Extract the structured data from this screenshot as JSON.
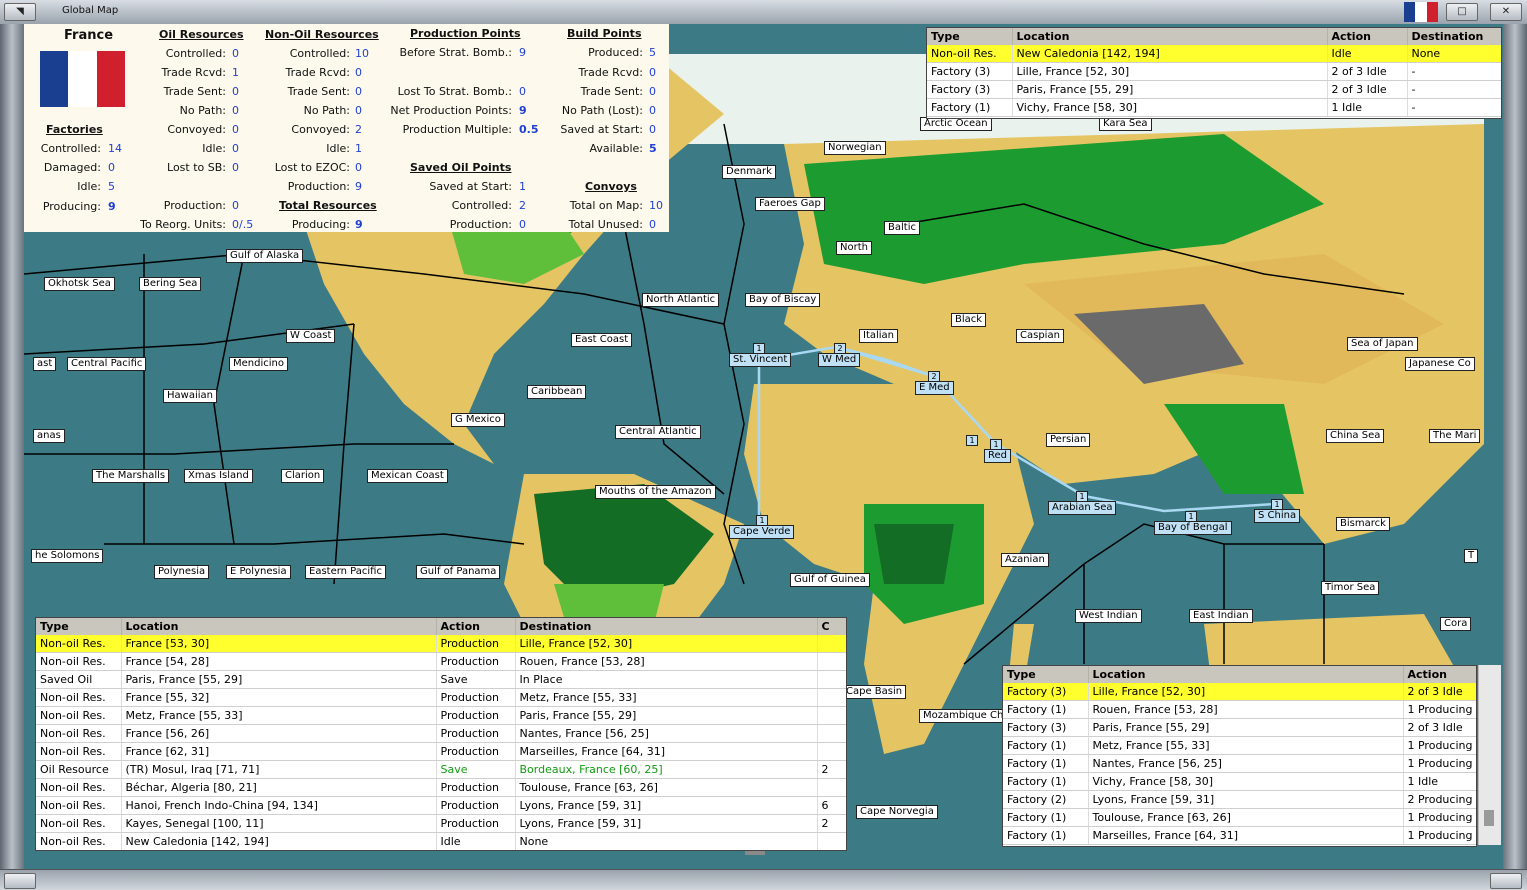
{
  "window": {
    "title": "Global Map"
  },
  "summary": {
    "country": "France",
    "factories": {
      "heading": "Factories",
      "rows": [
        {
          "label": "Controlled:",
          "value": "14"
        },
        {
          "label": "Damaged:",
          "value": "0"
        },
        {
          "label": "Idle:",
          "value": "5"
        },
        {
          "label": "Producing:",
          "value": "9"
        }
      ]
    },
    "oil": {
      "heading": "Oil Resources",
      "rows": [
        {
          "label": "Controlled:",
          "value": "0"
        },
        {
          "label": "Trade Rcvd:",
          "value": "1"
        },
        {
          "label": "Trade Sent:",
          "value": "0"
        },
        {
          "label": "No Path:",
          "value": "0"
        },
        {
          "label": "Convoyed:",
          "value": "0"
        },
        {
          "label": "Idle:",
          "value": "0"
        },
        {
          "label": "Lost to SB:",
          "value": "0"
        },
        {
          "label": "Production:",
          "value": "0"
        },
        {
          "label": "To Reorg. Units:",
          "value": "0/.5"
        }
      ]
    },
    "nonoil": {
      "heading": "Non-Oil Resources",
      "rows": [
        {
          "label": "Controlled:",
          "value": "10"
        },
        {
          "label": "Trade Rcvd:",
          "value": "0"
        },
        {
          "label": "Trade Sent:",
          "value": "0"
        },
        {
          "label": "No Path:",
          "value": "0"
        },
        {
          "label": "Convoyed:",
          "value": "2"
        },
        {
          "label": "Idle:",
          "value": "1"
        },
        {
          "label": "Lost to EZOC:",
          "value": "0"
        },
        {
          "label": "Production:",
          "value": "9"
        }
      ]
    },
    "total": {
      "heading": "Total Resources",
      "label": "Producing:",
      "value": "9"
    },
    "production": {
      "heading": "Production Points",
      "rows": [
        {
          "label": "Before Strat. Bomb.:",
          "value": "9"
        },
        {
          "label": "Lost To Strat. Bomb.:",
          "value": "0"
        },
        {
          "label": "Net Production Points:",
          "value": "9"
        },
        {
          "label": "Production Multiple:",
          "value": "0.5"
        }
      ]
    },
    "saved_oil": {
      "heading": "Saved Oil Points",
      "rows": [
        {
          "label": "Saved at Start:",
          "value": "1"
        },
        {
          "label": "Controlled:",
          "value": "2"
        },
        {
          "label": "Production:",
          "value": "0"
        }
      ]
    },
    "build": {
      "heading": "Build Points",
      "rows": [
        {
          "label": "Produced:",
          "value": "5"
        },
        {
          "label": "Trade Rcvd:",
          "value": "0"
        },
        {
          "label": "Trade Sent:",
          "value": "0"
        },
        {
          "label": "No Path (Lost):",
          "value": "0"
        },
        {
          "label": "Saved at Start:",
          "value": "0"
        },
        {
          "label": "Available:",
          "value": "5"
        }
      ]
    },
    "convoys": {
      "heading": "Convoys",
      "rows": [
        {
          "label": "Total on Map:",
          "value": "10"
        },
        {
          "label": "Total Unused:",
          "value": "0"
        }
      ]
    }
  },
  "top_right_table": {
    "columns": [
      "Type",
      "Location",
      "Action",
      "Destination"
    ],
    "rows": [
      [
        "Non-oil Res.",
        "New Caledonia [142, 194]",
        "Idle",
        "None"
      ],
      [
        "Factory (3)",
        "Lille, France [52, 30]",
        "2 of 3 Idle",
        "-"
      ],
      [
        "Factory (3)",
        "Paris, France [55, 29]",
        "2 of 3 Idle",
        "-"
      ],
      [
        "Factory (1)",
        "Vichy, France [58, 30]",
        "1 Idle",
        "-"
      ]
    ]
  },
  "resources_table": {
    "columns": [
      "Type",
      "Location",
      "Action",
      "Destination",
      "C"
    ],
    "rows": [
      [
        "Non-oil Res.",
        "France [53, 30]",
        "Production",
        "Lille, France [52, 30]",
        ""
      ],
      [
        "Non-oil Res.",
        "France [54, 28]",
        "Production",
        "Rouen, France [53, 28]",
        ""
      ],
      [
        "Saved Oil",
        "Paris, France [55, 29]",
        "Save",
        "In Place",
        ""
      ],
      [
        "Non-oil Res.",
        "France [55, 32]",
        "Production",
        "Metz, France [55, 33]",
        ""
      ],
      [
        "Non-oil Res.",
        "Metz, France [55, 33]",
        "Production",
        "Paris, France [55, 29]",
        ""
      ],
      [
        "Non-oil Res.",
        "France [56, 26]",
        "Production",
        "Nantes, France [56, 25]",
        ""
      ],
      [
        "Non-oil Res.",
        "France [62, 31]",
        "Production",
        "Marseilles, France [64, 31]",
        ""
      ],
      [
        "Oil Resource",
        "(TR) Mosul, Iraq [71, 71]",
        "Save",
        "Bordeaux, France [60, 25]",
        "2"
      ],
      [
        "Non-oil Res.",
        "Béchar, Algeria [80, 21]",
        "Production",
        "Toulouse, France [63, 26]",
        ""
      ],
      [
        "Non-oil Res.",
        "Hanoi, French Indo-China [94, 134]",
        "Production",
        "Lyons, France [59, 31]",
        "6"
      ],
      [
        "Non-oil Res.",
        "Kayes, Senegal [100, 11]",
        "Production",
        "Lyons, France [59, 31]",
        "2"
      ],
      [
        "Non-oil Res.",
        "New Caledonia [142, 194]",
        "Idle",
        "None",
        ""
      ]
    ]
  },
  "factories_table": {
    "columns": [
      "Type",
      "Location",
      "Action"
    ],
    "rows": [
      [
        "Factory (3)",
        "Lille, France [52, 30]",
        "2 of 3 Idle"
      ],
      [
        "Factory (1)",
        "Rouen, France [53, 28]",
        "1 Producing"
      ],
      [
        "Factory (3)",
        "Paris, France [55, 29]",
        "2 of 3 Idle"
      ],
      [
        "Factory (1)",
        "Metz, France [55, 33]",
        "1 Producing"
      ],
      [
        "Factory (1)",
        "Nantes, France [56, 25]",
        "1 Producing"
      ],
      [
        "Factory (1)",
        "Vichy, France [58, 30]",
        "1 Idle"
      ],
      [
        "Factory (2)",
        "Lyons, France [59, 31]",
        "2 Producing"
      ],
      [
        "Factory (1)",
        "Toulouse, France [63, 26]",
        "1 Producing"
      ],
      [
        "Factory (1)",
        "Marseilles, France [64, 31]",
        "1 Producing"
      ]
    ]
  },
  "sea_zones": [
    "Arctic Ocean",
    "Kara Sea",
    "Norwegian",
    "Denmark",
    "Faeroes Gap",
    "Baltic",
    "North",
    "Bay of Biscay",
    "North Atlantic",
    "Italian",
    "Black",
    "Caspian",
    "East Coast",
    "Gulf of Alaska",
    "Okhotsk Sea",
    "Bering Sea",
    "W Coast",
    "ast",
    "Central Pacific",
    "Mendicino",
    "Hawaiian",
    "anas",
    "Caribbean",
    "G Mexico",
    "Central Atlantic",
    "Persian",
    "Sea of Japan",
    "Japanese Co",
    "China Sea",
    "The Mari",
    "The Marshalls",
    "Xmas Island",
    "Clarion",
    "Mexican Coast",
    "Mouths of the Amazon",
    "he Solomons",
    "Polynesia",
    "E Polynesia",
    "Eastern Pacific",
    "Gulf of Panama",
    "Gulf of Guinea",
    "Azanian",
    "Bismarck",
    "Timor Sea",
    "West Indian",
    "East Indian",
    "Cora",
    "Cape Basin",
    "Mozambique Cha",
    "Cape Norvegia",
    "T"
  ],
  "convoy_route_labels": [
    "St. Vincent",
    "W Med",
    "E Med",
    "Red",
    "Arabian Sea",
    "Bay of Bengal",
    "S China",
    "Cape Verde"
  ],
  "convoy_route_numbers": [
    "1",
    "2",
    "2",
    "1",
    "1",
    "1",
    "1",
    "1",
    "1"
  ]
}
